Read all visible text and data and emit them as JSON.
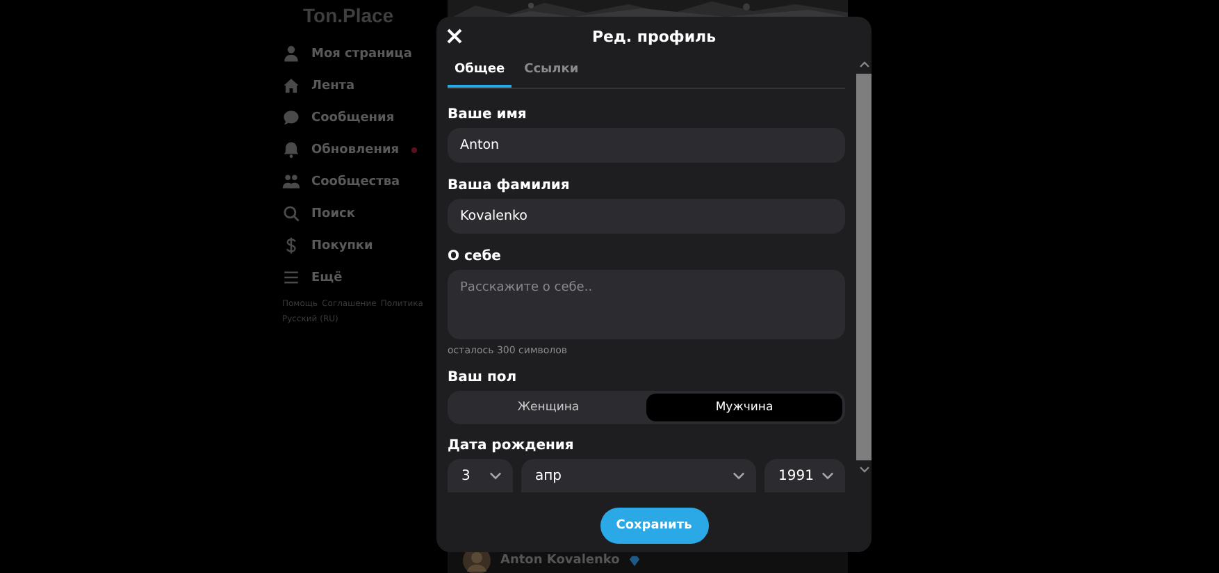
{
  "sidebar": {
    "logo": "Ton.Place",
    "items": [
      {
        "label": "Моя страница",
        "kind": "user",
        "unread": false
      },
      {
        "label": "Лента",
        "kind": "home",
        "unread": false
      },
      {
        "label": "Сообщения",
        "kind": "chat",
        "unread": false
      },
      {
        "label": "Обновления",
        "kind": "bell",
        "unread": true
      },
      {
        "label": "Сообщества",
        "kind": "group",
        "unread": false
      },
      {
        "label": "Поиск",
        "kind": "search",
        "unread": false
      },
      {
        "label": "Покупки",
        "kind": "dollar",
        "unread": false
      },
      {
        "label": "Ещё",
        "kind": "menu",
        "unread": false
      }
    ],
    "footer_links": [
      "Помощь",
      "Соглашение",
      "Политика"
    ],
    "language": "Русский (RU)"
  },
  "feed": {
    "post_author": "Anton Kovalenko",
    "verified": true
  },
  "modal": {
    "title": "Ред. профиль",
    "tabs": [
      {
        "label": "Общее",
        "selected": true
      },
      {
        "label": "Ссылки",
        "selected": false
      }
    ],
    "fields": [
      {
        "label": "Ваше имя",
        "value": "Anton"
      },
      {
        "label": "Ваша фамилия",
        "value": "Kovalenko"
      }
    ],
    "about": {
      "label": "О себе",
      "placeholder": "Расскажите о себе..",
      "counter": "осталось 300 символов"
    },
    "gender": {
      "label": "Ваш пол",
      "options": [
        {
          "label": "Женщина",
          "selected": false
        },
        {
          "label": "Мужчина",
          "selected": true
        }
      ]
    },
    "birthdate": {
      "label": "Дата рождения",
      "day": "3",
      "month": "апр",
      "year": "1991"
    },
    "save": "Сохранить"
  }
}
